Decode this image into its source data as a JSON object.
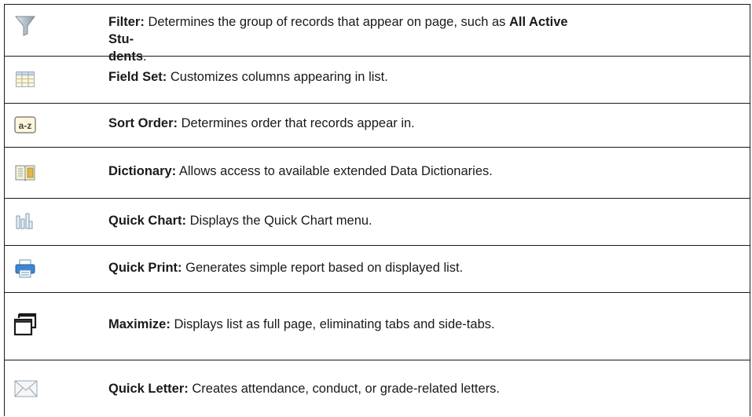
{
  "rows": [
    {
      "icon": "filter-icon",
      "title": "Filter:",
      "desc": "Determines the group of records that appear on page, such as ",
      "emph": "All Active Students",
      "tail": "."
    },
    {
      "icon": "field-set-icon",
      "title": "Field Set:",
      "desc": "Customizes columns appearing in list."
    },
    {
      "icon": "sort-order-icon",
      "title": "Sort Order:",
      "desc": "Determines order that records appear in."
    },
    {
      "icon": "dictionary-icon",
      "title": "Dictionary:",
      "desc": "Allows access to available extended Data Dictionaries."
    },
    {
      "icon": "quick-chart-icon",
      "title": "Quick Chart:",
      "desc": "Displays the Quick Chart menu."
    },
    {
      "icon": "quick-print-icon",
      "title": "Quick Print:",
      "desc": "Generates simple report based on displayed list."
    },
    {
      "icon": "maximize-icon",
      "title": "Maximize:",
      "desc": "Displays list as full page, eliminating tabs and side-tabs."
    },
    {
      "icon": "quick-letter-icon",
      "title": "Quick Letter:",
      "desc": "Creates attendance, conduct, or grade-related letters."
    }
  ],
  "sort_icon_text": "a-z"
}
